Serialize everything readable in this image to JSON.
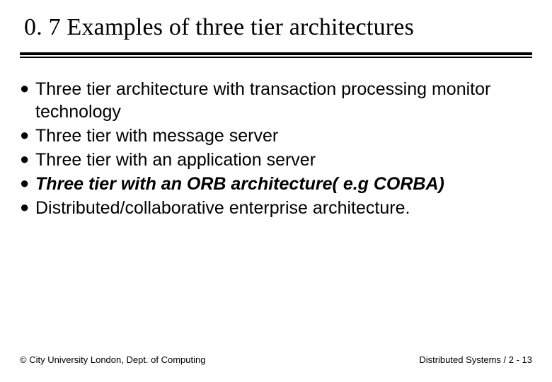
{
  "title": "0. 7 Examples of three tier architectures",
  "items": [
    {
      "text": "Three tier architecture with transaction processing monitor technology",
      "bold": false
    },
    {
      "text": "Three tier with message server",
      "bold": false
    },
    {
      "text": "Three tier with an application server",
      "bold": false
    },
    {
      "text": "Three tier with an ORB architecture( e.g CORBA)",
      "bold": true
    },
    {
      "text": "Distributed/collaborative enterprise architecture.",
      "bold": false
    }
  ],
  "footer": {
    "left": "© City University London, Dept. of Computing",
    "right": "Distributed Systems / 2 - 13"
  }
}
